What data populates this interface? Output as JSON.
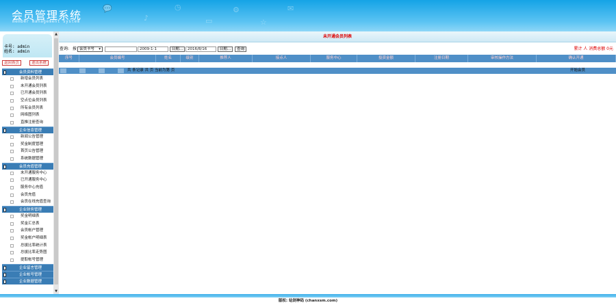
{
  "header": {
    "title": "会员管理系统",
    "subtitle": "member management system"
  },
  "user": {
    "card_line": "卡号: admin",
    "name_line": "姓名: admin"
  },
  "top_buttons": {
    "home": "返回首页",
    "logout": "退出系统"
  },
  "menu": [
    {
      "group": "会员资料管理",
      "items": [
        "新增会员列表",
        "未开通会员列表",
        "已开通会员列表",
        "空点位会员列表",
        "所有会员列表",
        "网络图列表",
        "直推注册查询"
      ]
    },
    {
      "group": "企业信息管理",
      "items": [
        "新闻公告管理",
        "奖金制度管理",
        "首页公告管理",
        "系统数据管理"
      ]
    },
    {
      "group": "会员充值管理",
      "items": [
        "未开通服务中心",
        "已开通服务中心",
        "服务中心充值",
        "会员充值",
        "会员在线充值查询"
      ]
    },
    {
      "group": "企业财务管理",
      "items": [
        "奖金明细表",
        "奖金汇总表",
        "会员帐户管理",
        "奖金帐户明细表",
        "总拔比率统计表",
        "总拔比率走势图",
        "提取帐号管理"
      ]
    },
    {
      "group": "企业留言管理",
      "items": []
    },
    {
      "group": "企业帐号管理",
      "items": []
    },
    {
      "group": "企业数据管理",
      "items": []
    }
  ],
  "main": {
    "title": "未开通会员列表",
    "filter": {
      "query_label": "查询:",
      "by_label": "按",
      "field_select": "会员卡号",
      "keyword": "",
      "date_from": "2009-1-1",
      "date_btn_1": "日期...",
      "date_to": "2016/8/16",
      "date_btn_2": "日期...",
      "search_btn": "查询",
      "stats": "累计  人 消费总额  0元"
    },
    "columns": [
      "序号",
      "会员编号",
      "姓名",
      "级别",
      "推荐人",
      "接点人",
      "服务中心",
      "投资金额",
      "注册日期",
      "审核操作方法",
      "确认开通"
    ],
    "pager": {
      "text": "共  条记录  共 页  当前为第 页",
      "right": "开始会员"
    }
  },
  "footer": {
    "copyright": "版权: 站剑神码 (chanxsm.com)"
  }
}
